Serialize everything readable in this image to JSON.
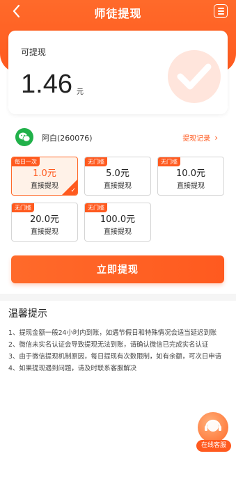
{
  "header": {
    "title": "师徒提现"
  },
  "balance": {
    "label": "可提现",
    "amount": "1.46",
    "unit": "元"
  },
  "account": {
    "name": "阿白(260076)",
    "record_label": "提现记录",
    "record_arrow": "›"
  },
  "options": [
    {
      "tag": "每日一次",
      "amount": "1.0元",
      "sub": "直接提现",
      "selected": true
    },
    {
      "tag": "无门槛",
      "amount": "5.0元",
      "sub": "直接提现",
      "selected": false
    },
    {
      "tag": "无门槛",
      "amount": "10.0元",
      "sub": "直接提现",
      "selected": false
    },
    {
      "tag": "无门槛",
      "amount": "20.0元",
      "sub": "直接提现",
      "selected": false
    },
    {
      "tag": "无门槛",
      "amount": "100.0元",
      "sub": "直接提现",
      "selected": false
    }
  ],
  "checkmark": "✓",
  "action": {
    "withdraw_label": "立即提现"
  },
  "tips": {
    "title": "温馨提示",
    "items": [
      "1、提现金额一般24小时内到账，如遇节假日和特殊情况会适当延迟到账",
      "2、微信未实名认证会导致提现无法到账，请确认微信已完成实名认证",
      "3、由于微信提现机制原因，每日提现有次数限制，如有余额，可次日申请",
      "4、如果提现遇到问题，请及时联系客服解决"
    ]
  },
  "support": {
    "label": "在线客服"
  },
  "colors": {
    "accent": "#ff5a1f",
    "wechat": "#21b14a"
  }
}
